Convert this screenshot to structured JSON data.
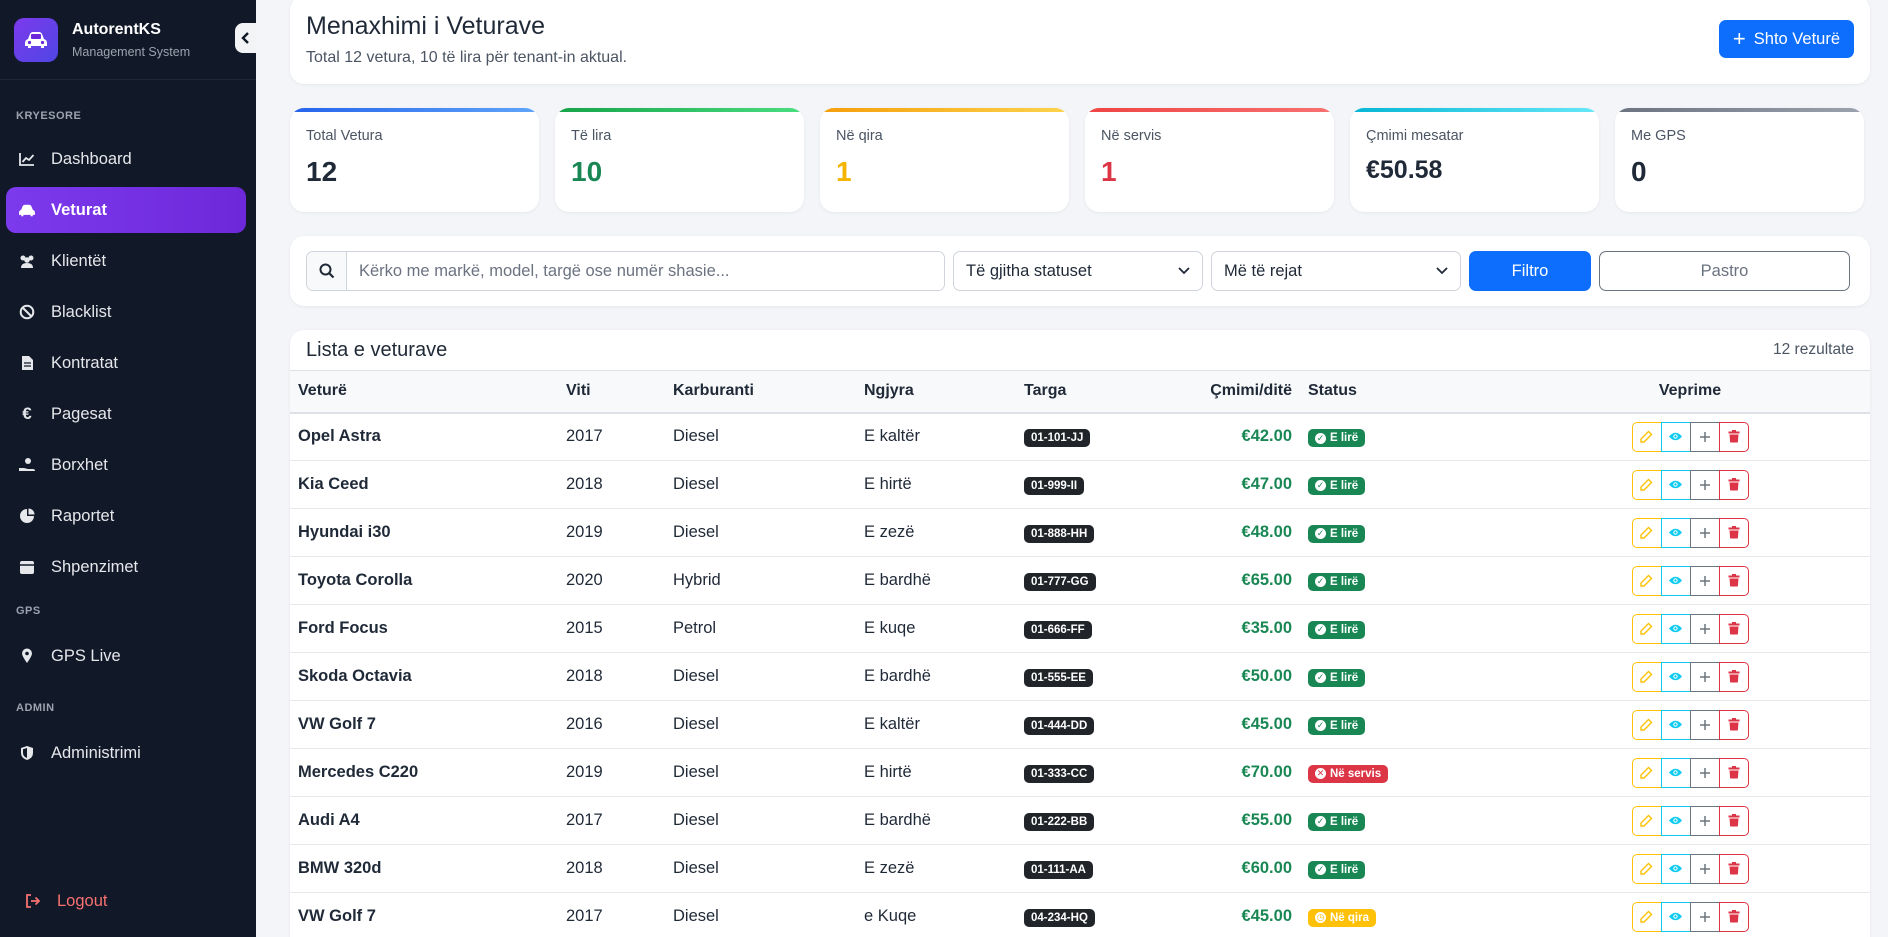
{
  "brand": {
    "name": "AutorentKS",
    "subtitle": "Management System"
  },
  "sidebar": {
    "sections": [
      {
        "label": "KRYESORE",
        "items": [
          {
            "label": "Dashboard",
            "icon": "chart-line-icon"
          },
          {
            "label": "Veturat",
            "icon": "car-icon",
            "active": true
          },
          {
            "label": "Klientët",
            "icon": "users-icon"
          },
          {
            "label": "Blacklist",
            "icon": "ban-icon"
          },
          {
            "label": "Kontratat",
            "icon": "file-icon"
          },
          {
            "label": "Pagesat",
            "icon": "euro-icon"
          },
          {
            "label": "Borxhet",
            "icon": "hand-coins-icon"
          },
          {
            "label": "Raportet",
            "icon": "pie-chart-icon"
          },
          {
            "label": "Shpenzimet",
            "icon": "receipt-icon"
          }
        ]
      },
      {
        "label": "GPS",
        "items": [
          {
            "label": "GPS Live",
            "icon": "map-pin-icon"
          }
        ]
      },
      {
        "label": "ADMIN",
        "items": [
          {
            "label": "Administrimi",
            "icon": "shield-icon"
          }
        ]
      }
    ],
    "logout": "Logout"
  },
  "header": {
    "title": "Menaxhimi i Veturave",
    "subtitle": "Total 12 vetura, 10 të lira për tenant-in aktual.",
    "add_button": "Shto Veturë"
  },
  "stats": [
    {
      "label": "Total Vetura",
      "value": "12",
      "accent": "#2563eb",
      "value_color": "#1f2937"
    },
    {
      "label": "Të lira",
      "value": "10",
      "accent": "#16a34a",
      "value_color": "#198754"
    },
    {
      "label": "Në qira",
      "value": "1",
      "accent": "#f59e0b",
      "value_color": "#f5b400"
    },
    {
      "label": "Në servis",
      "value": "1",
      "accent": "#ef4444",
      "value_color": "#dc3545"
    },
    {
      "label": "Çmimi mesatar",
      "value": "€50.58",
      "accent": "#06b6d4",
      "value_color": "#1f2937"
    },
    {
      "label": "Me GPS",
      "value": "0",
      "accent": "#6b7280",
      "value_color": "#1f2937"
    }
  ],
  "filters": {
    "search_placeholder": "Kërko me markë, model, targë ose numër shasie...",
    "status_select": "Të gjitha statuset",
    "sort_select": "Më të rejat",
    "filter_button": "Filtro",
    "clear_button": "Pastro"
  },
  "list": {
    "title": "Lista e veturave",
    "count": "12 rezultate",
    "columns": [
      "Veturë",
      "Viti",
      "Karburanti",
      "Ngjyra",
      "Targa",
      "Çmimi/ditë",
      "Status",
      "Veprime"
    ],
    "rows": [
      {
        "name": "Opel Astra",
        "year": "2017",
        "fuel": "Diesel",
        "color": "E kaltër",
        "plate": "01-101-JJ",
        "price": "€42.00",
        "status": "E lirë",
        "status_type": "free"
      },
      {
        "name": "Kia Ceed",
        "year": "2018",
        "fuel": "Diesel",
        "color": "E hirtë",
        "plate": "01-999-II",
        "price": "€47.00",
        "status": "E lirë",
        "status_type": "free"
      },
      {
        "name": "Hyundai i30",
        "year": "2019",
        "fuel": "Diesel",
        "color": "E zezë",
        "plate": "01-888-HH",
        "price": "€48.00",
        "status": "E lirë",
        "status_type": "free"
      },
      {
        "name": "Toyota Corolla",
        "year": "2020",
        "fuel": "Hybrid",
        "color": "E bardhë",
        "plate": "01-777-GG",
        "price": "€65.00",
        "status": "E lirë",
        "status_type": "free"
      },
      {
        "name": "Ford Focus",
        "year": "2015",
        "fuel": "Petrol",
        "color": "E kuqe",
        "plate": "01-666-FF",
        "price": "€35.00",
        "status": "E lirë",
        "status_type": "free"
      },
      {
        "name": "Skoda Octavia",
        "year": "2018",
        "fuel": "Diesel",
        "color": "E bardhë",
        "plate": "01-555-EE",
        "price": "€50.00",
        "status": "E lirë",
        "status_type": "free"
      },
      {
        "name": "VW Golf 7",
        "year": "2016",
        "fuel": "Diesel",
        "color": "E kaltër",
        "plate": "01-444-DD",
        "price": "€45.00",
        "status": "E lirë",
        "status_type": "free"
      },
      {
        "name": "Mercedes C220",
        "year": "2019",
        "fuel": "Diesel",
        "color": "E hirtë",
        "plate": "01-333-CC",
        "price": "€70.00",
        "status": "Në servis",
        "status_type": "service"
      },
      {
        "name": "Audi A4",
        "year": "2017",
        "fuel": "Diesel",
        "color": "E bardhë",
        "plate": "01-222-BB",
        "price": "€55.00",
        "status": "E lirë",
        "status_type": "free"
      },
      {
        "name": "BMW 320d",
        "year": "2018",
        "fuel": "Diesel",
        "color": "E zezë",
        "plate": "01-111-AA",
        "price": "€60.00",
        "status": "E lirë",
        "status_type": "free"
      },
      {
        "name": "VW Golf 7",
        "year": "2017",
        "fuel": "Diesel",
        "color": "e Kuqe",
        "plate": "04-234-HQ",
        "price": "€45.00",
        "status": "Në qira",
        "status_type": "rented"
      }
    ]
  },
  "status_colors": {
    "free": "#198754",
    "service": "#dc3545",
    "rented": "#ffc107"
  }
}
